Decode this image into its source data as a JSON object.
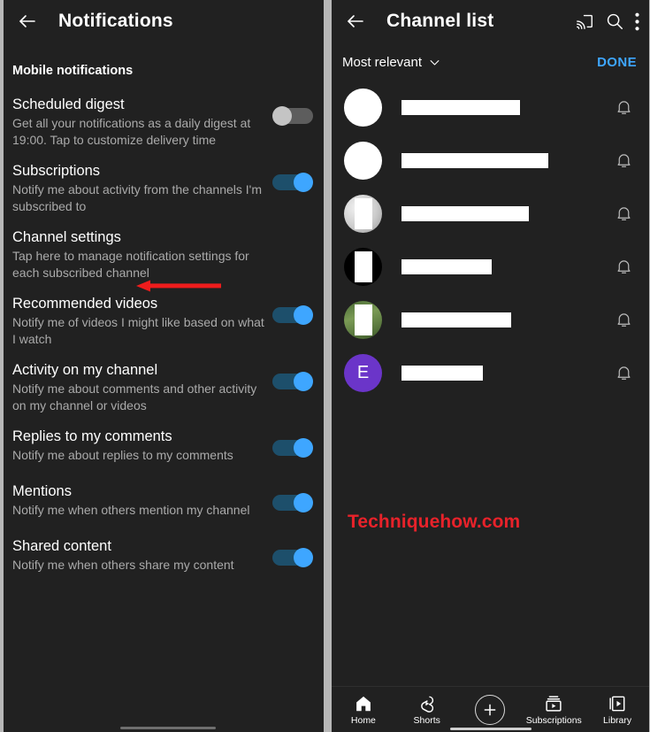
{
  "left_panel": {
    "appbar": {
      "back_icon": "arrow-left-icon",
      "title": "Notifications"
    },
    "section_header": "Mobile notifications",
    "settings": [
      {
        "title": "Scheduled digest",
        "subtitle": "Get all your notifications as a daily digest at 19:00. Tap to customize delivery time",
        "toggle": "off",
        "has_toggle": true
      },
      {
        "title": "Subscriptions",
        "subtitle": "Notify me about activity from the channels I'm subscribed to",
        "toggle": "on",
        "has_toggle": true
      },
      {
        "title": "Channel settings",
        "subtitle": "Tap here to manage notification settings for each subscribed channel",
        "toggle": "none",
        "has_toggle": false,
        "annotated": true
      },
      {
        "title": "Recommended videos",
        "subtitle": "Notify me of videos I might like based on what I watch",
        "toggle": "on",
        "has_toggle": true
      },
      {
        "title": "Activity on my channel",
        "subtitle": "Notify me about comments and other activity on my channel or videos",
        "toggle": "on",
        "has_toggle": true
      },
      {
        "title": "Replies to my comments",
        "subtitle": "Notify me about replies to my comments",
        "toggle": "on",
        "has_toggle": true
      },
      {
        "title": "Mentions",
        "subtitle": "Notify me when others mention my channel",
        "toggle": "on",
        "has_toggle": true
      },
      {
        "title": "Shared content",
        "subtitle": "Notify me when others share my content",
        "toggle": "on",
        "has_toggle": true
      }
    ],
    "annotation": {
      "type": "arrow",
      "points_to": "Channel settings",
      "color": "#ee1c1c"
    }
  },
  "right_panel": {
    "appbar": {
      "back_icon": "arrow-left-icon",
      "title": "Channel list",
      "actions": [
        "cast-icon",
        "search-icon",
        "overflow-menu-icon"
      ]
    },
    "sortbar": {
      "sort_label": "Most relevant",
      "chevron": "chevron-down-icon",
      "done_label": "DONE",
      "done_color": "#3ea6ff"
    },
    "channels": [
      {
        "name": "",
        "redacted": true,
        "redaction_width": 134,
        "avatar_style": "white",
        "avatar_initial": "",
        "bell": "bell-outline-icon"
      },
      {
        "name": "",
        "redacted": true,
        "redaction_width": 166,
        "avatar_style": "white",
        "avatar_initial": "",
        "bell": "bell-outline-icon"
      },
      {
        "name": "",
        "redacted": true,
        "redaction_width": 144,
        "avatar_style": "gray-gradient",
        "avatar_initial": "",
        "bell": "bell-outline-icon"
      },
      {
        "name": "",
        "redacted": true,
        "redaction_width": 102,
        "avatar_style": "black",
        "avatar_initial": "",
        "bell": "bell-outline-icon"
      },
      {
        "name": "",
        "redacted": true,
        "redaction_width": 124,
        "avatar_style": "green",
        "avatar_initial": "",
        "bell": "bell-outline-icon"
      },
      {
        "name": "",
        "redacted": true,
        "redaction_width": 92,
        "avatar_style": "purple",
        "avatar_initial": "E",
        "bell": "bell-outline-icon"
      }
    ],
    "watermark": "Techniquehow.com",
    "bottom_nav": [
      {
        "label": "Home",
        "icon": "home-icon"
      },
      {
        "label": "Shorts",
        "icon": "shorts-icon"
      },
      {
        "label": "",
        "icon": "plus-circle-icon"
      },
      {
        "label": "Subscriptions",
        "icon": "subscriptions-icon"
      },
      {
        "label": "Library",
        "icon": "library-icon"
      }
    ]
  },
  "theme": {
    "background": "#212121",
    "surface_gap": "#b7b7b7",
    "accent_blue": "#3ea6ff",
    "accent_red": "#e8222a",
    "text_primary": "#ffffff",
    "text_secondary": "#aaaaaa"
  }
}
